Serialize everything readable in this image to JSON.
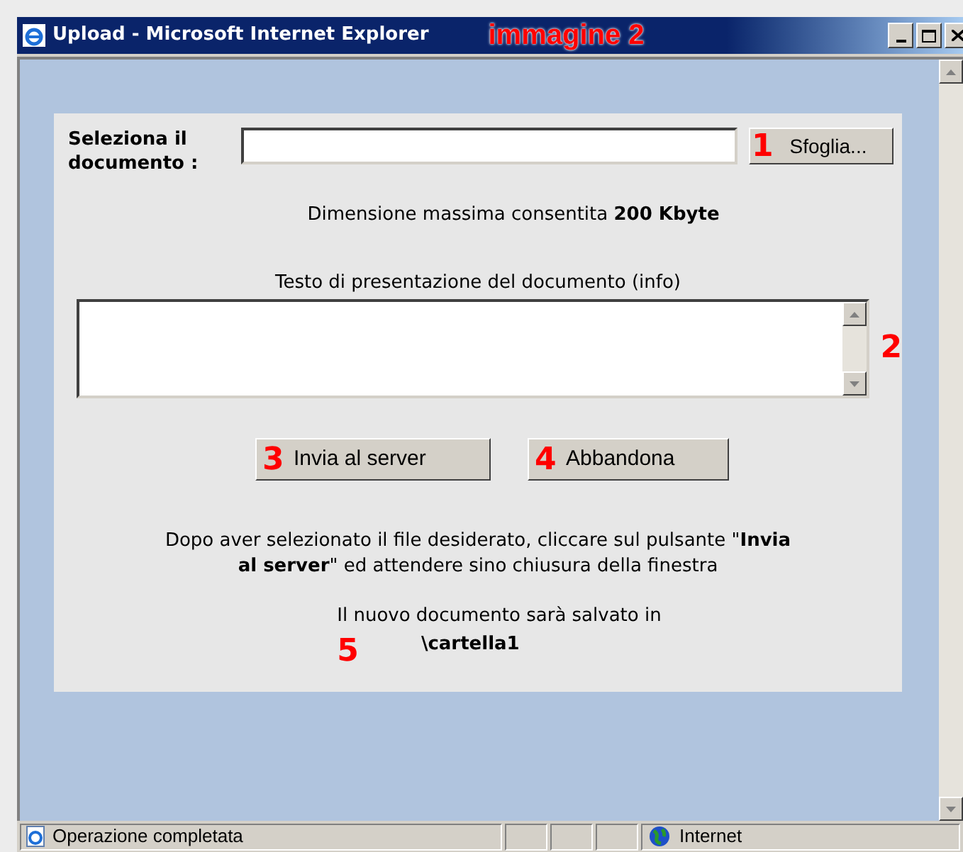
{
  "window": {
    "title": "Upload - Microsoft Internet Explorer",
    "annotation": "immagine 2"
  },
  "form": {
    "file_label": "Seleziona il documento :",
    "browse_button": "Sfoglia...",
    "browse_marker": "1",
    "max_size_prefix": "Dimensione massima consentita **200 Kbyte**",
    "info_label": "Testo di presentazione del documento (info)",
    "info_marker": "2",
    "buttons": [
      {
        "label": "Invia al server",
        "marker": "3"
      },
      {
        "label": "Abbandona",
        "marker": "4"
      }
    ],
    "instructions": "Dopo aver selezionato il file desiderato, cliccare sul pulsante \"**Invia al server**\" ed attendere sino chiusura della finestra",
    "save_note": "Il nuovo documento sarà salvato in",
    "folder": "\\cartella1",
    "folder_marker": "5"
  },
  "status_bar": {
    "message": "Operazione completata",
    "zone": "Internet"
  }
}
